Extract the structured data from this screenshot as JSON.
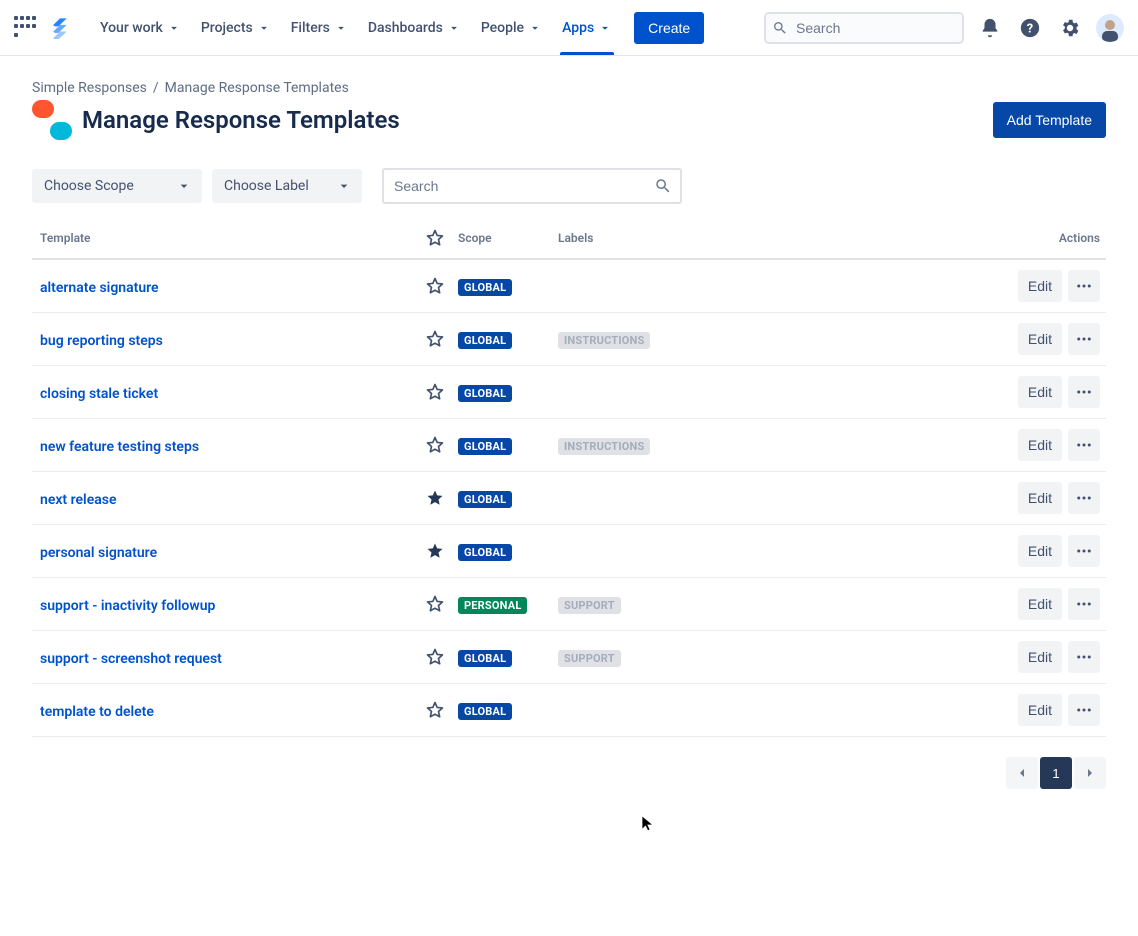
{
  "nav": {
    "items": [
      {
        "label": "Your work",
        "active": false
      },
      {
        "label": "Projects",
        "active": false
      },
      {
        "label": "Filters",
        "active": false
      },
      {
        "label": "Dashboards",
        "active": false
      },
      {
        "label": "People",
        "active": false
      },
      {
        "label": "Apps",
        "active": true
      }
    ],
    "create_label": "Create",
    "search_placeholder": "Search"
  },
  "breadcrumbs": [
    "Simple Responses",
    "Manage Response Templates"
  ],
  "page": {
    "title": "Manage Response Templates",
    "add_button": "Add Template"
  },
  "filters": {
    "scope_label": "Choose Scope",
    "label_label": "Choose Label",
    "search_placeholder": "Search"
  },
  "columns": {
    "template": "Template",
    "scope": "Scope",
    "labels": "Labels",
    "actions": "Actions"
  },
  "rows": [
    {
      "name": "alternate signature",
      "starred": false,
      "scope": "GLOBAL",
      "labels": []
    },
    {
      "name": "bug reporting steps",
      "starred": false,
      "scope": "GLOBAL",
      "labels": [
        "INSTRUCTIONS"
      ]
    },
    {
      "name": "closing stale ticket",
      "starred": false,
      "scope": "GLOBAL",
      "labels": []
    },
    {
      "name": "new feature testing steps",
      "starred": false,
      "scope": "GLOBAL",
      "labels": [
        "INSTRUCTIONS"
      ]
    },
    {
      "name": "next release",
      "starred": true,
      "scope": "GLOBAL",
      "labels": []
    },
    {
      "name": "personal signature",
      "starred": true,
      "scope": "GLOBAL",
      "labels": []
    },
    {
      "name": "support - inactivity followup",
      "starred": false,
      "scope": "PERSONAL",
      "labels": [
        "SUPPORT"
      ]
    },
    {
      "name": "support - screenshot request",
      "starred": false,
      "scope": "GLOBAL",
      "labels": [
        "SUPPORT"
      ]
    },
    {
      "name": "template to delete",
      "starred": false,
      "scope": "GLOBAL",
      "labels": []
    }
  ],
  "row_actions": {
    "edit": "Edit"
  },
  "pagination": {
    "current": "1"
  }
}
